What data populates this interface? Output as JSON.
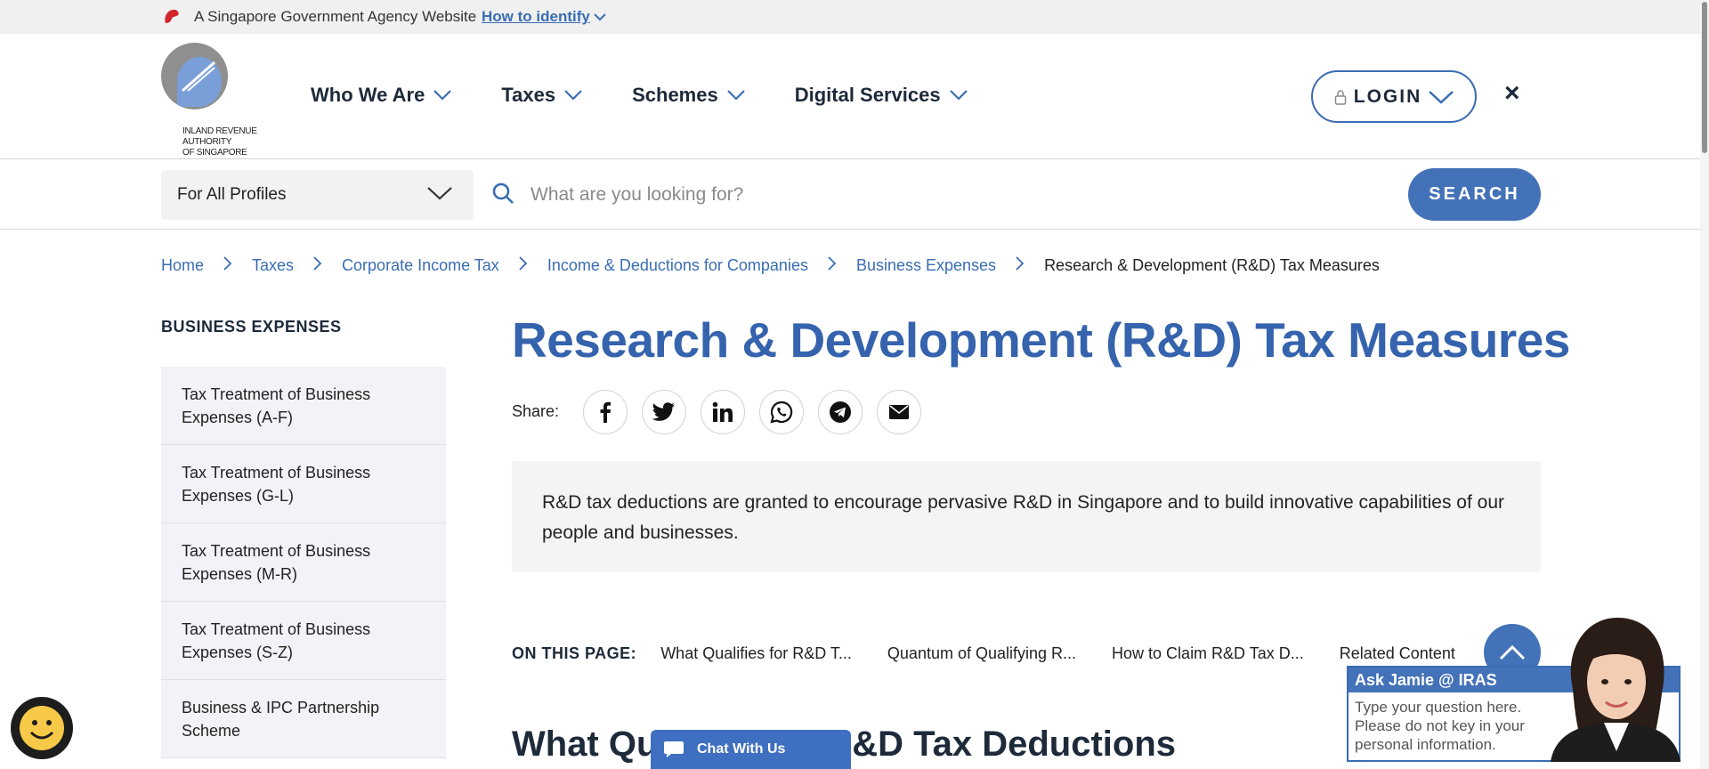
{
  "gov_banner": {
    "text": "A Singapore Government Agency Website",
    "link": "How to identify"
  },
  "logo": {
    "line1": "INLAND REVENUE",
    "line2": "AUTHORITY",
    "line3": "OF SINGAPORE"
  },
  "nav": {
    "items": [
      {
        "label": "Who We Are"
      },
      {
        "label": "Taxes"
      },
      {
        "label": "Schemes"
      },
      {
        "label": "Digital Services"
      }
    ],
    "login_label": "LOGIN",
    "close_label": "×"
  },
  "search": {
    "profile_value": "For All Profiles",
    "placeholder": "What are you looking for?",
    "button_label": "SEARCH"
  },
  "breadcrumb": [
    {
      "label": "Home"
    },
    {
      "label": "Taxes"
    },
    {
      "label": "Corporate Income Tax"
    },
    {
      "label": "Income & Deductions for Companies"
    },
    {
      "label": "Business Expenses"
    },
    {
      "label": "Research & Development (R&D) Tax Measures"
    }
  ],
  "sidebar": {
    "title": "BUSINESS EXPENSES",
    "items": [
      {
        "label": "Tax Treatment of Business Expenses (A-F)"
      },
      {
        "label": "Tax Treatment of Business Expenses (G-L)"
      },
      {
        "label": "Tax Treatment of Business Expenses (M-R)"
      },
      {
        "label": "Tax Treatment of Business Expenses (S-Z)"
      },
      {
        "label": "Business & IPC Partnership Scheme"
      }
    ]
  },
  "main": {
    "title": "Research & Development (R&D) Tax Measures",
    "share_label": "Share:",
    "share_icons": [
      "facebook-icon",
      "twitter-icon",
      "linkedin-icon",
      "whatsapp-icon",
      "telegram-icon",
      "email-icon"
    ],
    "summary": "R&D tax deductions are granted to encourage pervasive R&D in Singapore and to build innovative capabilities of our people and businesses.",
    "on_this_page_label": "ON THIS PAGE:",
    "on_this_page_links": [
      {
        "label": "What Qualifies for R&D T..."
      },
      {
        "label": "Quantum of Qualifying R..."
      },
      {
        "label": "How to Claim R&D Tax D..."
      },
      {
        "label": "Related Content"
      }
    ],
    "section_title": "What Qualifies for R&D Tax Deductions"
  },
  "chat": {
    "tab_label": "Chat With Us",
    "jamie_title": "Ask Jamie @ IRAS",
    "jamie_prompt": "Type your question here. Please do not key in your personal information."
  },
  "colors": {
    "brand_blue": "#3563ad",
    "button_blue": "#4472b8",
    "link_blue": "#3a6db3"
  }
}
